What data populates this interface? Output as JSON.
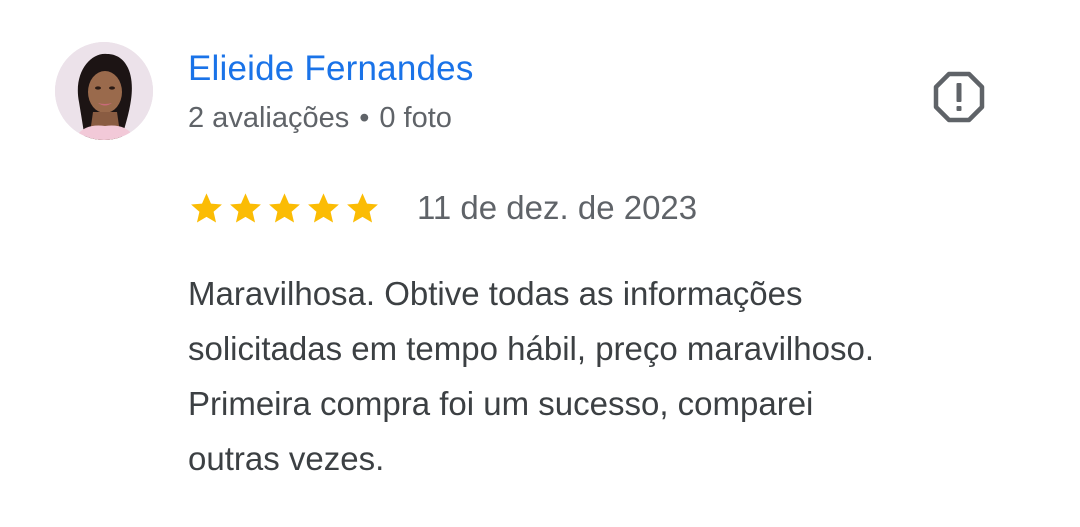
{
  "review": {
    "author": {
      "name": "Elieide Fernandes",
      "reviews_count": "2 avaliações",
      "separator": "•",
      "photos_count": "0 foto"
    },
    "rating": 5,
    "rating_max": 5,
    "date": "11 de dez. de 2023",
    "text": "Maravilhosa. Obtive todas as informações\nsolicitadas em tempo hábil, preço maravilhoso.\nPrimeira compra foi um sucesso, comparei\noutras vezes.",
    "icons": {
      "report": "report-flag-icon",
      "star": "star-icon",
      "avatar": "avatar-photo"
    },
    "colors": {
      "name": "#1a73e8",
      "star": "#fbbc04",
      "secondary_text": "#5f6368",
      "body_text": "#3c4043",
      "report_icon": "#5f6368"
    }
  }
}
